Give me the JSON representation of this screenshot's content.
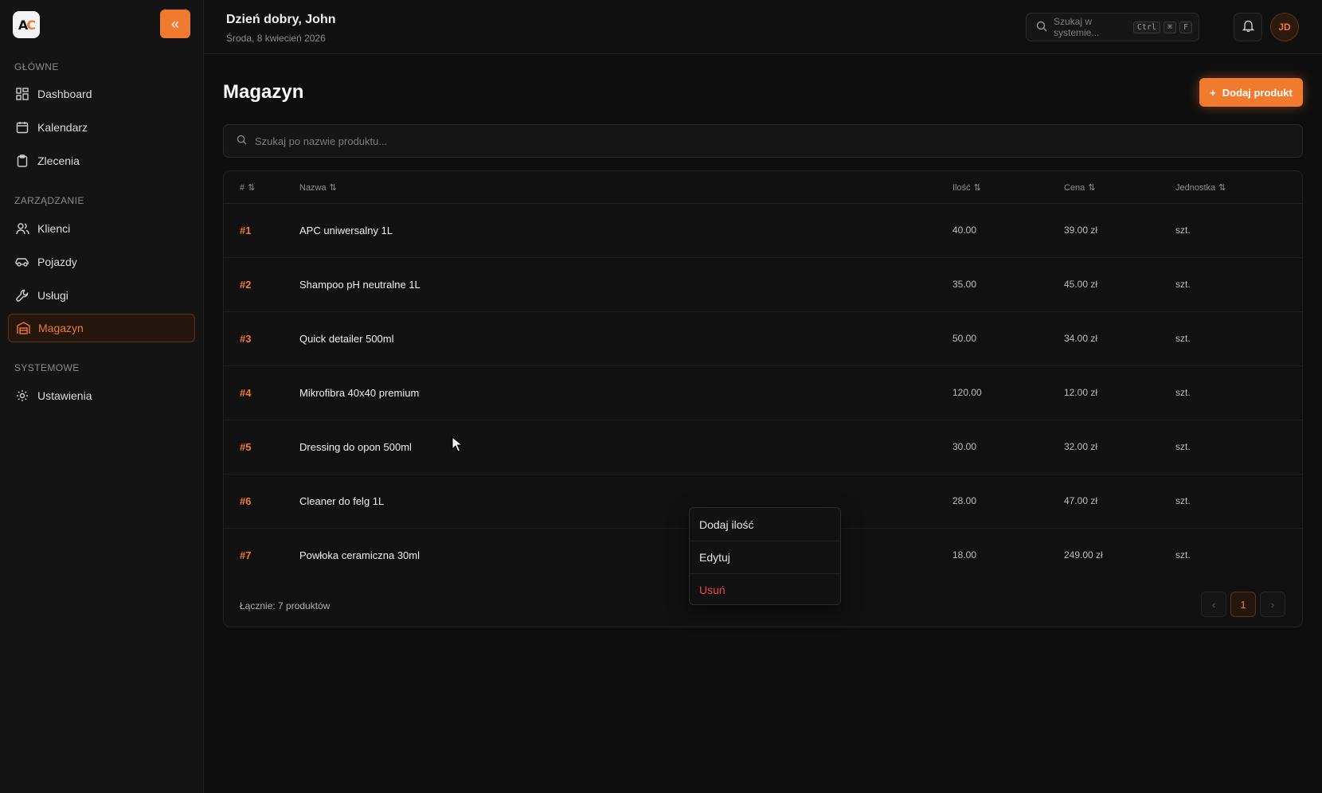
{
  "sidebar": {
    "logo_text": "AC",
    "sections": {
      "main": "GŁÓWNE",
      "management": "ZARZĄDZANIE",
      "system": "SYSTEMOWE"
    },
    "items": [
      {
        "label": "Dashboard",
        "icon": "dashboard-icon"
      },
      {
        "label": "Kalendarz",
        "icon": "calendar-icon"
      },
      {
        "label": "Zlecenia",
        "icon": "clipboard-icon"
      },
      {
        "label": "Klienci",
        "icon": "users-icon"
      },
      {
        "label": "Pojazdy",
        "icon": "car-icon"
      },
      {
        "label": "Usługi",
        "icon": "wrench-icon"
      },
      {
        "label": "Magazyn",
        "icon": "warehouse-icon",
        "active": true
      },
      {
        "label": "Ustawienia",
        "icon": "gear-icon"
      }
    ]
  },
  "header": {
    "greeting": "Dzień dobry, John",
    "date": "Środa, 8 kwiecień 2026",
    "search_placeholder": "Szukaj w systemie...",
    "shortcut": [
      "Ctrl",
      "⌘",
      "F"
    ],
    "avatar_initials": "JD"
  },
  "main": {
    "title": "Magazyn",
    "add_button": "Dodaj produkt",
    "search_placeholder": "Szukaj po nazwie produktu...",
    "columns": [
      "#",
      "Nazwa",
      "Ilość",
      "Cena",
      "Jednostka"
    ],
    "rows": [
      {
        "id": "#1",
        "name": "APC uniwersalny 1L",
        "qty": "40.00",
        "price": "39.00 zł",
        "unit": "szt."
      },
      {
        "id": "#2",
        "name": "Shampoo pH neutralne 1L",
        "qty": "35.00",
        "price": "45.00 zł",
        "unit": "szt."
      },
      {
        "id": "#3",
        "name": "Quick detailer 500ml",
        "qty": "50.00",
        "price": "34.00 zł",
        "unit": "szt."
      },
      {
        "id": "#4",
        "name": "Mikrofibra 40x40 premium",
        "qty": "120.00",
        "price": "12.00 zł",
        "unit": "szt."
      },
      {
        "id": "#5",
        "name": "Dressing do opon 500ml",
        "qty": "30.00",
        "price": "32.00 zł",
        "unit": "szt."
      },
      {
        "id": "#6",
        "name": "Cleaner do felg 1L",
        "qty": "28.00",
        "price": "47.00 zł",
        "unit": "szt."
      },
      {
        "id": "#7",
        "name": "Powłoka ceramiczna 30ml",
        "qty": "18.00",
        "price": "249.00 zł",
        "unit": "szt."
      }
    ],
    "total": "Łącznie: 7 produktów",
    "current_page": "1"
  },
  "context_menu": {
    "items": [
      "Dodaj ilość",
      "Edytuj",
      "Usuń"
    ]
  },
  "colors": {
    "accent": "#f07a2e",
    "danger": "#ef4444",
    "background": "#0e0e0f"
  }
}
